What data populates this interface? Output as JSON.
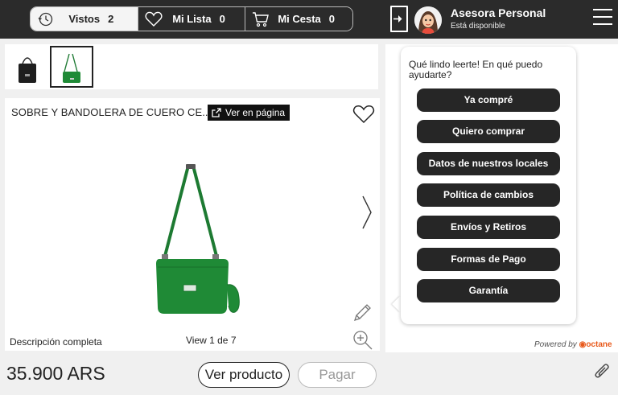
{
  "header": {
    "tabs": [
      {
        "label": "Vistos",
        "count": "2",
        "icon": "clock-history-icon"
      },
      {
        "label": "Mi Lista",
        "count": "0",
        "icon": "heart-icon"
      },
      {
        "label": "Mi Cesta",
        "count": "0",
        "icon": "cart-icon"
      }
    ],
    "agent": {
      "name": "Asesora Personal",
      "status": "Está disponible"
    }
  },
  "product": {
    "title": "SOBRE Y BANDOLERA DE CUERO CE...",
    "view_page_label": "Ver en página",
    "description_link": "Descripción completa",
    "view_counter": "View 1 de 7",
    "price": "35.900 ARS",
    "thumbnails": [
      {
        "color": "#1e1e1e",
        "selected": false
      },
      {
        "color": "#1f7a34",
        "selected": true
      }
    ]
  },
  "actions": {
    "view_product": "Ver producto",
    "pay": "Pagar"
  },
  "chat": {
    "greeting": "Qué lindo leerte! En qué puedo ayudarte?",
    "quick_replies": [
      "Ya compré",
      "Quiero comprar",
      "Datos de nuestros locales",
      "Política de cambios",
      "Envíos y Retiros",
      "Formas de Pago",
      "Garantía"
    ],
    "powered_by": "Powered by",
    "brand": "octane"
  },
  "colors": {
    "topbar": "#2b2b2b",
    "bag_green": "#1f8a36",
    "brand_orange": "#e85a1c"
  }
}
